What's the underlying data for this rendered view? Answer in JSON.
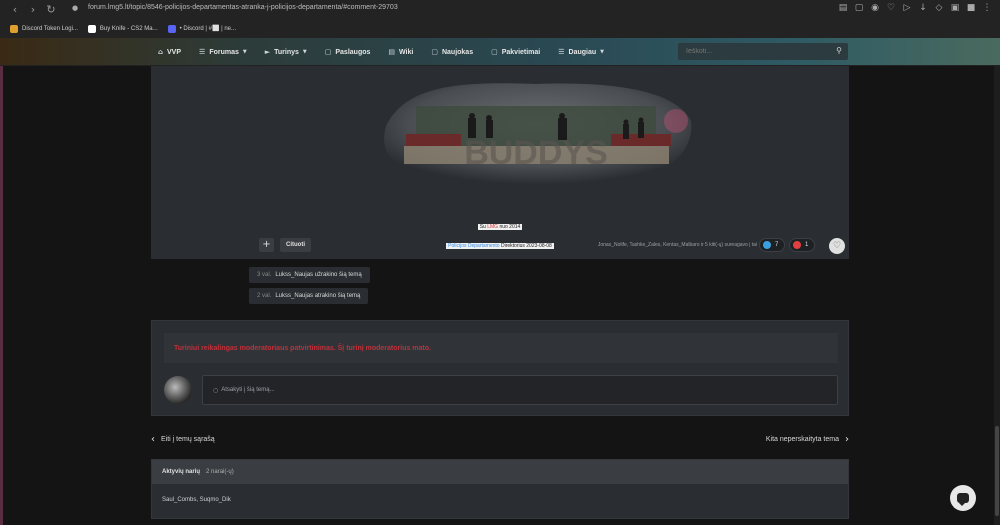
{
  "browser": {
    "url": "forum.lmg5.lt/topic/8546-policijos-departamentas-atranka-j-policijos-departamenta/#comment-29703",
    "bookmarks": [
      {
        "label": "Discord Token Logi...",
        "color": "#e0a030"
      },
      {
        "label": "Buy Knife - CS2 Ma...",
        "color": "#ffffff"
      },
      {
        "label": "• Discord | #⬜ | ne...",
        "color": "#5865f2"
      }
    ]
  },
  "nav": {
    "items": [
      {
        "label": "VVP",
        "icon": "home-icon"
      },
      {
        "label": "Forumas",
        "icon": "list-icon",
        "dropdown": true
      },
      {
        "label": "Turinys",
        "icon": "megaphone-icon",
        "dropdown": true
      },
      {
        "label": "Paslaugos",
        "icon": "document-icon"
      },
      {
        "label": "Wiki",
        "icon": "book-icon"
      },
      {
        "label": "Naujokas",
        "icon": "document-icon"
      },
      {
        "label": "Pakvietimai",
        "icon": "document-icon"
      },
      {
        "label": "Daugiau",
        "icon": "menu-icon",
        "dropdown": true
      }
    ],
    "search_placeholder": "Ieškoti..."
  },
  "post": {
    "signature_line1_prefix": "Su",
    "signature_line1_brand": "LMG",
    "signature_line1_suffix": "nuo 2014",
    "signature_line2_role": "Policijos Departamento",
    "signature_line2_rest": "Direktorius 2023-08-08",
    "quote_label": "Cituoti",
    "reacted_text": "Jonas_Nolife, Tashke_Zales, Kentas_Malbaro ir 5 kiti(-ų) sureagavo į tai",
    "reactions": [
      {
        "count": "7",
        "color": "#3aa0e0"
      },
      {
        "count": "1",
        "color": "#e04040"
      }
    ]
  },
  "moderation_log": [
    {
      "time": "3 val.",
      "text": "Lukss_Naujas užrakino šią temą"
    },
    {
      "time": "2 val.",
      "text": "Lukss_Naujas atrakino šią temą"
    }
  ],
  "reply": {
    "mod_notice": "Turiniui reikalingas moderatoriaus patvirtinimas. Šį turinį moderatorius mato.",
    "placeholder": "Atsakyti į šią temą..."
  },
  "pager": {
    "prev": "Eiti į temų sąrašą",
    "next": "Kita neperskaityta tema"
  },
  "active": {
    "title": "Aktyvių narių",
    "count": "2 narai(-ų)",
    "members": "Saul_Combs, Suqmo_Dik"
  }
}
